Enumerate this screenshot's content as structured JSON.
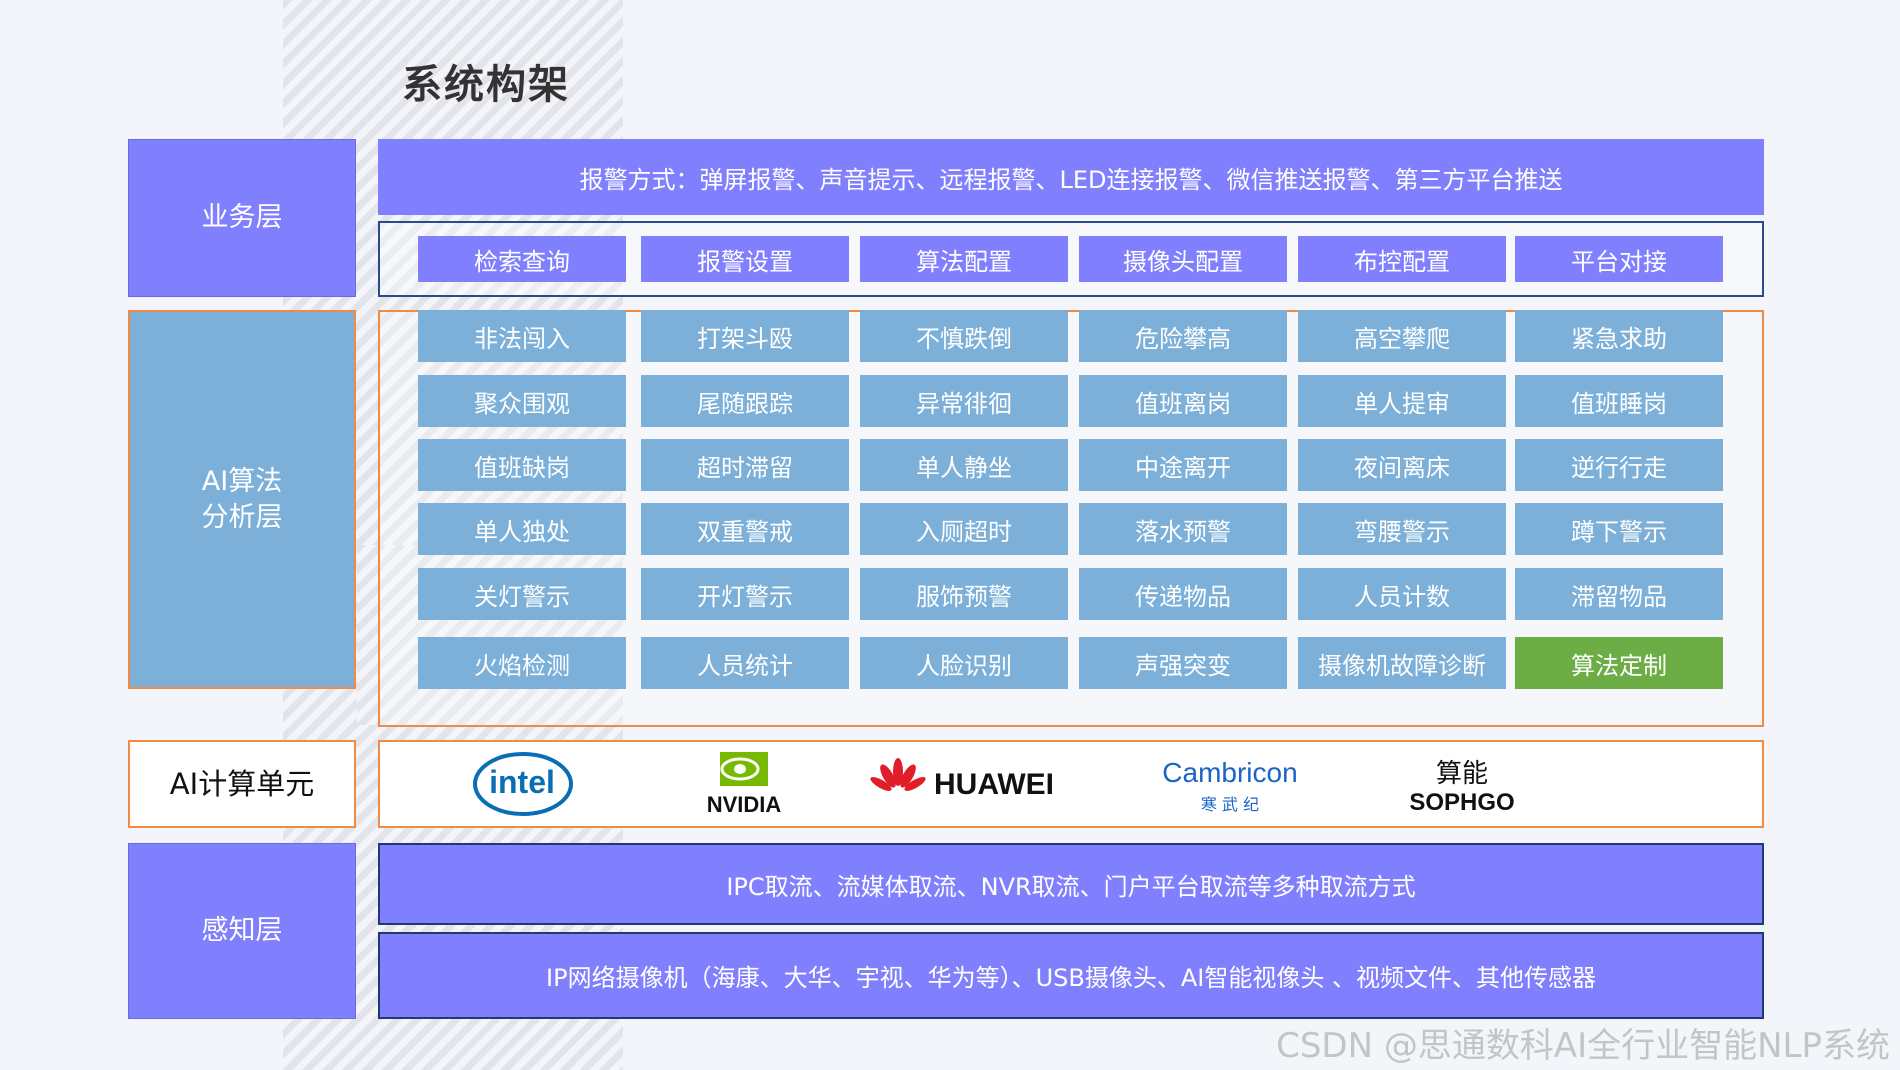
{
  "title": "系统构架",
  "layers": {
    "business": "业务层",
    "ai_line1": "AI算法",
    "ai_line2": "分析层",
    "compute": "AI计算单元",
    "perception": "感知层"
  },
  "alarm_banner": "报警方式：弹屏报警、声音提示、远程报警、LED连接报警、微信推送报警、第三方平台推送",
  "functions": [
    "检索查询",
    "报警设置",
    "算法配置",
    "摄像头配置",
    "布控配置",
    "平台对接"
  ],
  "algorithms": [
    [
      "非法闯入",
      "打架斗殴",
      "不慎跌倒",
      "危险攀高",
      "高空攀爬",
      "紧急求助"
    ],
    [
      "聚众围观",
      "尾随跟踪",
      "异常徘徊",
      "值班离岗",
      "单人提审",
      "值班睡岗"
    ],
    [
      "值班缺岗",
      "超时滞留",
      "单人静坐",
      "中途离开",
      "夜间离床",
      "逆行行走"
    ],
    [
      "单人独处",
      "双重警戒",
      "入厕超时",
      "落水预警",
      "弯腰警示",
      "蹲下警示"
    ],
    [
      "关灯警示",
      "开灯警示",
      "服饰预警",
      "传递物品",
      "人员计数",
      "滞留物品"
    ],
    [
      "火焰检测",
      "人员统计",
      "人脸识别",
      "声强突变",
      "摄像机故障诊断",
      "算法定制"
    ]
  ],
  "compute_logos": {
    "intel": "intel",
    "nvidia": "NVIDIA",
    "huawei": "HUAWEI",
    "cambricon_en": "Cambricon",
    "cambricon_cn": "寒  武  纪",
    "sophgo_cn": "算能",
    "sophgo_en": "SOPHGO"
  },
  "perception_banners": [
    "IPC取流、流媒体取流、NVR取流、门户平台取流等多种取流方式",
    "IP网络摄像机（海康、大华、宇视、华为等）、USB摄像头、AI智能视像头 、视频文件、其他传感器"
  ],
  "watermark": "CSDN @思通数科AI全行业智能NLP系统",
  "colors": {
    "purple": "#8080ff",
    "blue": "#7db0d9",
    "green": "#6cad45",
    "orange": "#f08a45",
    "navy": "#2a4a8a"
  }
}
